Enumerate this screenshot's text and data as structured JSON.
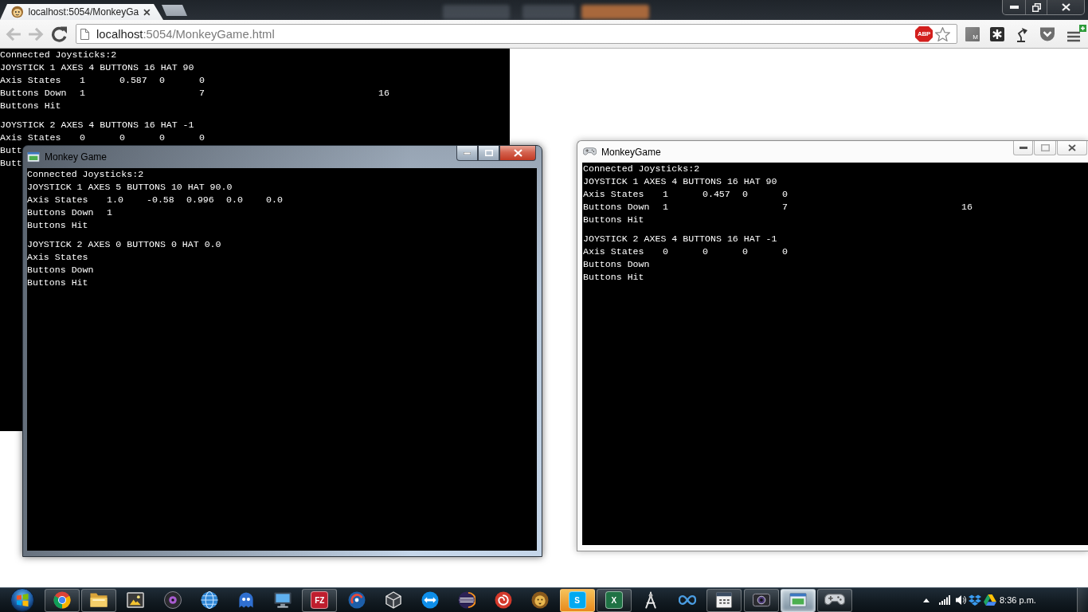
{
  "browser": {
    "tabs": [
      {
        "title": "localhost:5054/MonkeyGa",
        "selected": true
      }
    ],
    "navigation": [
      {
        "kind": "back",
        "disabled": true
      },
      {
        "kind": "forward",
        "disabled": true
      },
      {
        "kind": "reload",
        "disabled": false
      }
    ],
    "address": {
      "host": "localhost",
      "path": ":5054/MonkeyGame.html"
    },
    "adblock_badge": "ABP",
    "extension_badge": "M"
  },
  "page_console": {
    "status": "Connected Joysticks:2",
    "joysticks": [
      {
        "header": "JOYSTICK 1 AXES 4 BUTTONS 16 HAT 90",
        "rows": [
          {
            "kind": "axes",
            "label": "Axis States",
            "values": [
              "1",
              "0.587",
              "0",
              "0"
            ]
          },
          {
            "kind": "buttons",
            "label": "Buttons Down",
            "values": [
              "1",
              "7",
              "16"
            ]
          },
          {
            "kind": "buttons",
            "label": "Buttons Hit"
          }
        ]
      },
      {
        "header": "JOYSTICK 2 AXES 4 BUTTONS 16 HAT -1",
        "rows": [
          {
            "kind": "axes",
            "label": "Axis States",
            "values": [
              "0",
              "0",
              "0",
              "0"
            ]
          },
          {
            "kind": "buttons",
            "label": "Butt"
          },
          {
            "kind": "buttons",
            "label": "Butt"
          }
        ]
      }
    ]
  },
  "windows": [
    {
      "kind": "aero",
      "title": "Monkey Game",
      "console": {
        "status": "Connected Joysticks:2",
        "joysticks": [
          {
            "header": "JOYSTICK 1 AXES 5 BUTTONS 10 HAT 90.0",
            "rows": [
              {
                "kind": "axes",
                "label": "Axis States",
                "values": [
                  "1.0",
                  "-0.58",
                  "0.996",
                  "0.0",
                  "0.0"
                ]
              },
              {
                "kind": "buttons",
                "label": "Buttons Down",
                "values": [
                  "1"
                ]
              },
              {
                "kind": "buttons",
                "label": "Buttons Hit"
              }
            ]
          },
          {
            "header": "JOYSTICK 2 AXES 0 BUTTONS 0 HAT 0.0",
            "rows": [
              {
                "kind": "axes",
                "label": "Axis States"
              },
              {
                "kind": "buttons",
                "label": "Buttons Down"
              },
              {
                "kind": "buttons",
                "label": "Buttons Hit"
              }
            ]
          }
        ]
      }
    },
    {
      "kind": "basic",
      "title": "MonkeyGame",
      "console": {
        "status": "Connected Joysticks:2",
        "joysticks": [
          {
            "header": "JOYSTICK 1 AXES 4 BUTTONS 16 HAT 90",
            "rows": [
              {
                "kind": "axes",
                "label": "Axis States",
                "values": [
                  "1",
                  "0.457",
                  "0",
                  "0"
                ]
              },
              {
                "kind": "buttons",
                "label": "Buttons Down",
                "values": [
                  "1",
                  "7",
                  "16"
                ]
              },
              {
                "kind": "buttons",
                "label": "Buttons Hit"
              }
            ]
          },
          {
            "header": "JOYSTICK 2 AXES 4 BUTTONS 16 HAT -1",
            "rows": [
              {
                "kind": "axes",
                "label": "Axis States",
                "values": [
                  "0",
                  "0",
                  "0",
                  "0"
                ]
              },
              {
                "kind": "buttons",
                "label": "Buttons Down"
              },
              {
                "kind": "buttons",
                "label": "Buttons Hit"
              }
            ]
          }
        ]
      }
    }
  ],
  "taskbar": {
    "apps": [
      {
        "kind": "circle-logo",
        "open": true,
        "selected": false,
        "flashing": false
      },
      {
        "kind": "folder",
        "open": true,
        "selected": false,
        "flashing": false
      },
      {
        "kind": "picture",
        "open": false,
        "selected": false,
        "flashing": false
      },
      {
        "kind": "disc",
        "open": false,
        "selected": false,
        "flashing": false
      },
      {
        "kind": "globe",
        "open": false,
        "selected": false,
        "flashing": false
      },
      {
        "kind": "ghost",
        "open": false,
        "selected": false,
        "flashing": false
      },
      {
        "kind": "monitor",
        "open": false,
        "selected": false,
        "flashing": false
      },
      {
        "kind": "text-tile",
        "text": "FZ",
        "color": "#bf1e2e",
        "open": true,
        "selected": false,
        "flashing": false
      },
      {
        "kind": "swirl",
        "open": false,
        "selected": false,
        "flashing": false
      },
      {
        "kind": "cube",
        "open": false,
        "selected": false,
        "flashing": false
      },
      {
        "kind": "arrows",
        "open": false,
        "selected": false,
        "flashing": false
      },
      {
        "kind": "striped-sphere",
        "open": false,
        "selected": false,
        "flashing": false
      },
      {
        "kind": "spiral",
        "open": false,
        "selected": false,
        "flashing": false
      },
      {
        "kind": "lion",
        "open": false,
        "selected": false,
        "flashing": false
      },
      {
        "kind": "text-tile",
        "text": "S",
        "color": "#00a9f0",
        "open": true,
        "selected": false,
        "flashing": true
      },
      {
        "kind": "text-tile",
        "text": "X",
        "color": "#1f7244",
        "open": true,
        "selected": false,
        "flashing": false
      },
      {
        "kind": "compass",
        "open": false,
        "selected": false,
        "flashing": false
      },
      {
        "kind": "infinity",
        "open": false,
        "selected": false,
        "flashing": false
      },
      {
        "kind": "calendar",
        "open": true,
        "selected": false,
        "flashing": false
      },
      {
        "kind": "camera",
        "open": true,
        "selected": false,
        "flashing": false
      },
      {
        "kind": "window",
        "open": true,
        "selected": true,
        "flashing": false
      },
      {
        "kind": "gamepad",
        "open": true,
        "selected": false,
        "flashing": false
      }
    ],
    "clock": "8:36 p.m."
  }
}
